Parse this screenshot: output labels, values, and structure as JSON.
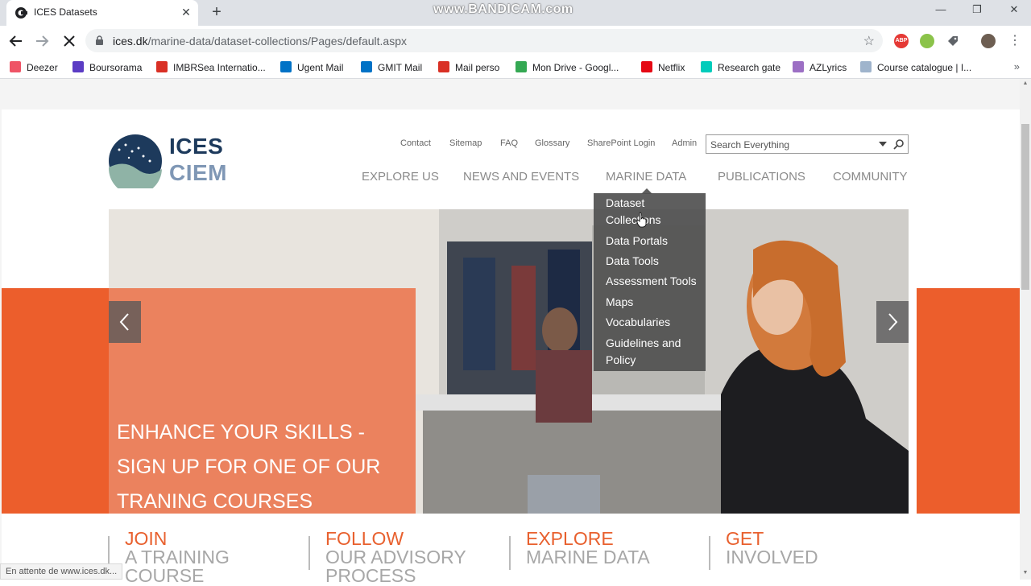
{
  "browser": {
    "tab_title": "ICES Datasets",
    "tab_close": "✕",
    "new_tab": "+",
    "recorder_watermark": "www.BANDICAM.com",
    "window_controls": [
      "—",
      "❐",
      "✕"
    ],
    "url_host": "ices.dk",
    "url_path": "/marine-data/dataset-collections/Pages/default.aspx",
    "extensions": [
      {
        "label": "ABP",
        "color": "#e53935"
      },
      {
        "label": "",
        "color": "#8bc34a"
      },
      {
        "label": "",
        "color": "#5f6368"
      },
      {
        "label": "",
        "color": "#6d5e52"
      }
    ]
  },
  "bookmarks": [
    {
      "label": "Deezer",
      "color": "#ef5466"
    },
    {
      "label": "Boursorama",
      "color": "#5b3cc4"
    },
    {
      "label": "IMBRSea Internatio...",
      "color": "#d93025"
    },
    {
      "label": "Ugent Mail",
      "color": "#0072c6"
    },
    {
      "label": "GMIT Mail",
      "color": "#0072c6"
    },
    {
      "label": "Mail perso",
      "color": "#d93025"
    },
    {
      "label": "Mon Drive - Googl...",
      "color": "#34a853"
    },
    {
      "label": "Netflix",
      "color": "#e50914"
    },
    {
      "label": "Research gate",
      "color": "#00ccbb"
    },
    {
      "label": "AZLyrics",
      "color": "#9c6fc4"
    },
    {
      "label": "Course catalogue | I...",
      "color": "#9fb4cc"
    }
  ],
  "bookmarks_more": "»",
  "site": {
    "logo_top": "ICES",
    "logo_bottom": "CIEM",
    "top_links": [
      "Contact",
      "Sitemap",
      "FAQ",
      "Glossary",
      "SharePoint Login",
      "Admin"
    ],
    "search_placeholder": "Search Everything",
    "main_nav": [
      "EXPLORE US",
      "NEWS AND EVENTS",
      "MARINE DATA",
      "PUBLICATIONS",
      "COMMUNITY"
    ],
    "dropdown": [
      [
        "Dataset",
        "Collections"
      ],
      [
        "Data Portals"
      ],
      [
        "Data Tools"
      ],
      [
        "Assessment Tools"
      ],
      [
        "Maps"
      ],
      [
        "Vocabularies"
      ],
      [
        "Guidelines and",
        "Policy"
      ]
    ],
    "hero_lines": [
      "ENHANCE YOUR SKILLS -",
      "SIGN UP FOR ONE OF OUR",
      "TRANING COURSES"
    ],
    "cta": [
      {
        "l1": "JOIN",
        "l2": "A TRAINING",
        "l3": "COURSE"
      },
      {
        "l1": "FOLLOW",
        "l2": "OUR ADVISORY",
        "l3": "PROCESS"
      },
      {
        "l1": "EXPLORE",
        "l2": "MARINE DATA",
        "l3": ""
      },
      {
        "l1": "GET",
        "l2": "INVOLVED",
        "l3": ""
      }
    ]
  },
  "status_text": "En attente de www.ices.dk...",
  "colors": {
    "accent_orange": "#ec5e2c",
    "logo_navy": "#1d3a5c",
    "logo_teal": "#8fb3a6",
    "logo_ciem": "#7f97b5"
  }
}
